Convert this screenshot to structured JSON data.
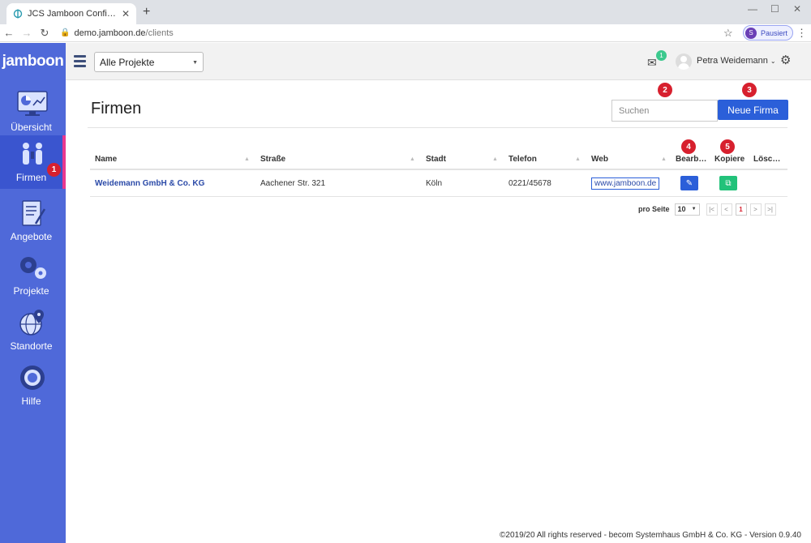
{
  "browser": {
    "tab_title": "JCS Jamboon Configuration Serv",
    "tab_close": "✕",
    "new_tab": "+",
    "url_host": "demo.jamboon.de",
    "url_path": "/clients",
    "profile_initial": "S",
    "profile_label": "Pausiert"
  },
  "header": {
    "logo": "jamboon",
    "project_select": "Alle Projekte",
    "mail_badge": "1",
    "user_name": "Petra Weidemann"
  },
  "sidebar": {
    "items": [
      {
        "label": "Übersicht"
      },
      {
        "label": "Firmen",
        "badge": "1"
      },
      {
        "label": "Angebote"
      },
      {
        "label": "Projekte"
      },
      {
        "label": "Standorte"
      },
      {
        "label": "Hilfe"
      }
    ]
  },
  "main": {
    "title": "Firmen",
    "search_placeholder": "Suchen",
    "new_button": "Neue Firma",
    "markers": [
      "2",
      "3",
      "4",
      "5"
    ],
    "columns": [
      "Name",
      "Straße",
      "Stadt",
      "Telefon",
      "Web",
      "Bearb…",
      "Kopiere",
      "Lösc…"
    ],
    "rows": [
      {
        "name": "Weidemann GmbH & Co. KG",
        "street": "Aachener Str. 321",
        "city": "Köln",
        "phone": "0221/45678",
        "web": "www.jamboon.de"
      }
    ],
    "pager": {
      "label": "pro Seite",
      "size": "10",
      "first": "|<",
      "prev": "<",
      "current": "1",
      "next": ">",
      "last": ">|"
    }
  },
  "footer": "©2019/20 All rights reserved - becom Systemhaus GmbH & Co. KG - Version 0.9.40",
  "colors": {
    "sidebar": "#4f69d9",
    "primary": "#2b5fd9",
    "copy": "#22c27a",
    "marker": "#d7202e"
  }
}
